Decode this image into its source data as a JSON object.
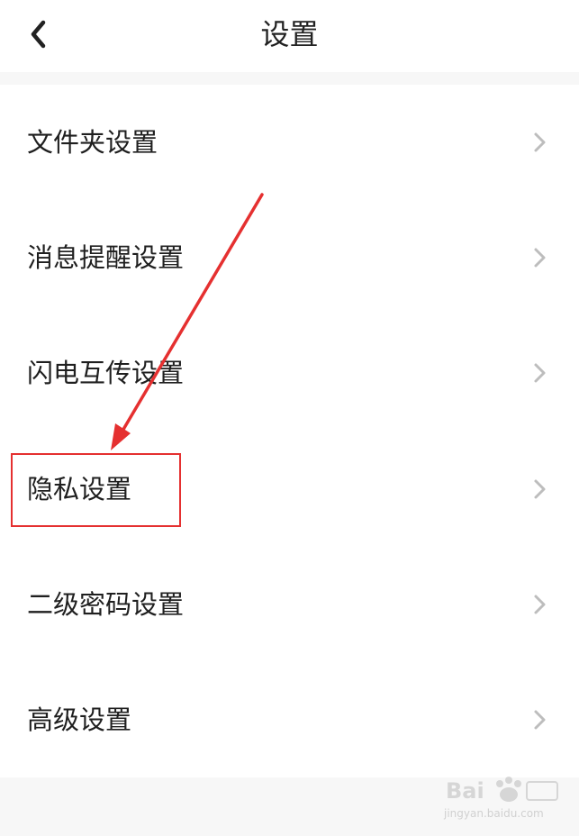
{
  "header": {
    "title": "设置",
    "back_icon": "chevron-left-icon"
  },
  "settings": {
    "items": [
      {
        "label": "文件夹设置"
      },
      {
        "label": "消息提醒设置"
      },
      {
        "label": "闪电互传设置"
      },
      {
        "label": "隐私设置"
      },
      {
        "label": "二级密码设置"
      },
      {
        "label": "高级设置"
      }
    ],
    "chevron_icon": "chevron-right-icon"
  },
  "annotation": {
    "highlighted_item": "隐私设置",
    "color": "#e53030"
  },
  "watermark": {
    "text": "jingyan.baidu.com"
  }
}
